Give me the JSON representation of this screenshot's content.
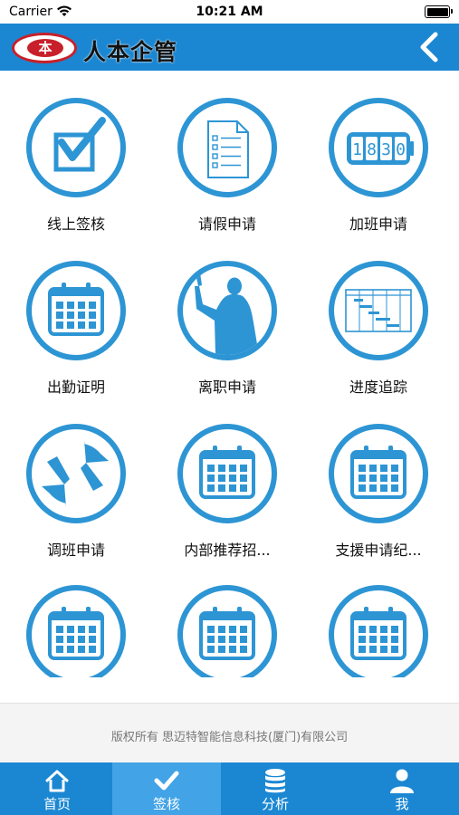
{
  "status_bar": {
    "carrier": "Carrier",
    "time": "10:21 AM"
  },
  "header": {
    "logo_badge": "本",
    "title": "人本企管",
    "back_icon": "chevron-left-icon"
  },
  "colors": {
    "primary": "#1b87d2",
    "icon_blue": "#2d95d4",
    "tab_active": "#42a3e6",
    "logo_red": "#c8202a"
  },
  "grid": {
    "items": [
      {
        "label": "线上签核",
        "icon": "checkbox-icon"
      },
      {
        "label": "请假申请",
        "icon": "document-list-icon"
      },
      {
        "label": "加班申请",
        "icon": "digital-clock-icon"
      },
      {
        "label": "出勤证明",
        "icon": "calendar-icon"
      },
      {
        "label": "离职申请",
        "icon": "person-waving-icon"
      },
      {
        "label": "进度追踪",
        "icon": "gantt-chart-icon"
      },
      {
        "label": "调班申请",
        "icon": "swap-arrows-icon"
      },
      {
        "label": "内部推荐招...",
        "icon": "calendar-icon"
      },
      {
        "label": "支援申请纪...",
        "icon": "calendar-icon"
      },
      {
        "label": "",
        "icon": "calendar-icon"
      },
      {
        "label": "",
        "icon": "calendar-icon"
      },
      {
        "label": "",
        "icon": "calendar-icon"
      }
    ]
  },
  "footer": {
    "copyright": "版权所有 思迈特智能信息科技(厦门)有限公司"
  },
  "tabbar": {
    "tabs": [
      {
        "label": "首页",
        "icon": "home-icon",
        "active": false
      },
      {
        "label": "签核",
        "icon": "checkmark-icon",
        "active": true
      },
      {
        "label": "分析",
        "icon": "database-icon",
        "active": false
      },
      {
        "label": "我",
        "icon": "user-icon",
        "active": false
      }
    ]
  },
  "clock_digits": "1830",
  "battery_level": 1.0
}
